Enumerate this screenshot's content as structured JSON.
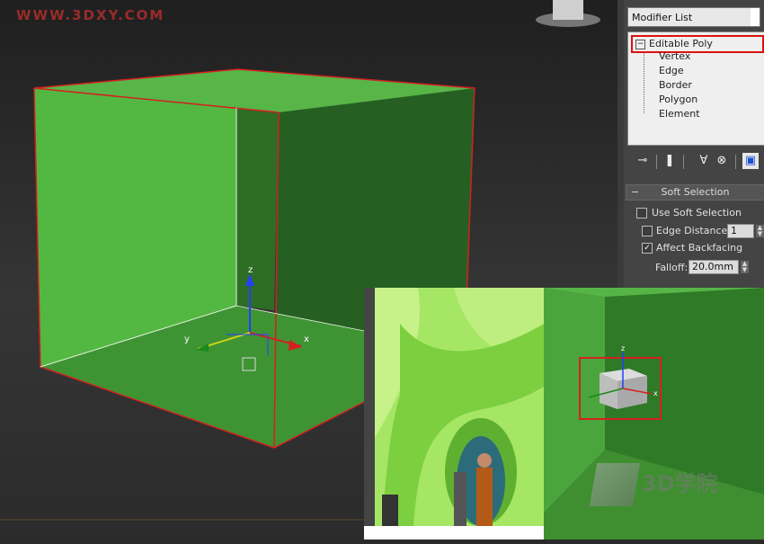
{
  "watermark": "WWW.3DXY.COM",
  "viewport": {
    "axis_labels": {
      "z": "z",
      "y": "y",
      "x": "x"
    }
  },
  "panel": {
    "modifier_list_label": "Modifier List",
    "stack": {
      "root": "Editable Poly",
      "root_toggle": "−",
      "subobjects": [
        "Vertex",
        "Edge",
        "Border",
        "Polygon",
        "Element"
      ]
    },
    "toolbar_icons": [
      "pin-stack-icon",
      "show-end-result-icon",
      "make-unique-icon",
      "remove-modifier-icon",
      "configure-sets-icon"
    ],
    "soft_selection": {
      "title": "Soft Selection",
      "collapse": "−",
      "use_soft_selection": {
        "label": "Use Soft Selection",
        "checked": false
      },
      "edge_distance": {
        "label": "Edge Distance:",
        "checked": false,
        "value": "1"
      },
      "affect_backfacing": {
        "label": "Affect Backfacing",
        "checked": true,
        "mark": "✓"
      },
      "falloff": {
        "label": "Falloff:",
        "value": "20.0mm"
      }
    }
  },
  "inset_render": {
    "axis_labels": {
      "z": "z",
      "x": "x"
    }
  },
  "logo_text": "3D学院",
  "colors": {
    "box_green": "#49a83b",
    "selection_red": "#d42020",
    "panel_bg": "#444444"
  }
}
